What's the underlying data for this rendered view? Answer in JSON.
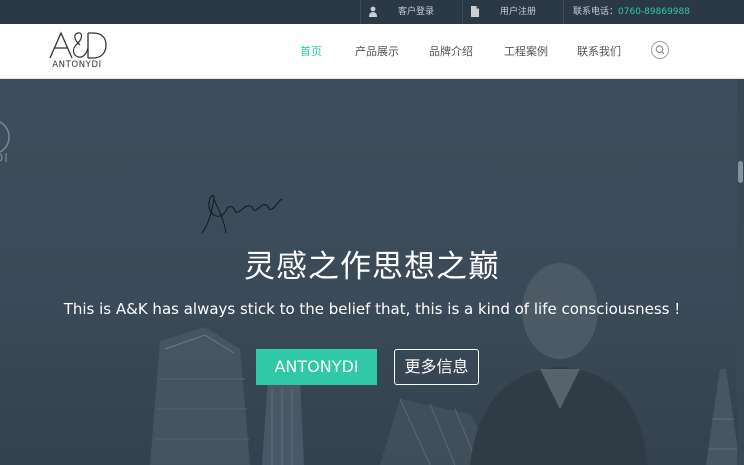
{
  "topbar": {
    "login_label": "客户登录",
    "register_label": "用户注册",
    "phone_label": "联系电话：",
    "phone_number": "0760-89869988"
  },
  "logo": {
    "mark": "A&D",
    "text": "ANTONYDI"
  },
  "nav": {
    "items": [
      {
        "label": "首页",
        "active": true
      },
      {
        "label": "产品展示",
        "active": false
      },
      {
        "label": "品牌介绍",
        "active": false
      },
      {
        "label": "工程案例",
        "active": false
      },
      {
        "label": "联系我们",
        "active": false
      }
    ]
  },
  "hero": {
    "signature": "Antonydi",
    "title": "灵感之作思想之巅",
    "subtitle": "This is A&K has always stick to the belief that, this is a kind of life consciousness !",
    "primary_button": "ANTONYDI",
    "secondary_button": "更多信息",
    "partial_logo_text": "DI"
  },
  "colors": {
    "accent": "#2fc9a8",
    "topbar_bg": "#2b3845",
    "hero_bg": "#3d4c5a"
  }
}
